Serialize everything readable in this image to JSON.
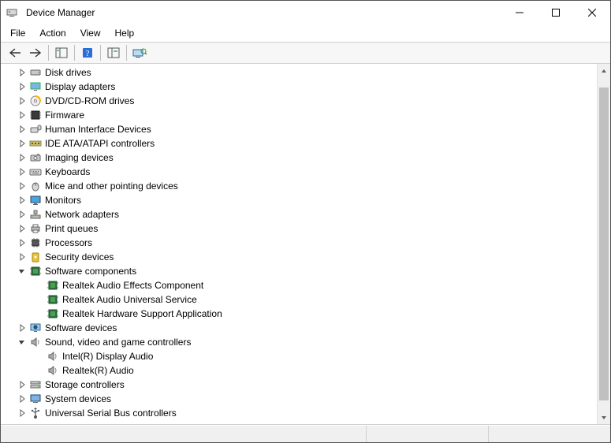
{
  "title": "Device Manager",
  "menu": {
    "items": [
      "File",
      "Action",
      "View",
      "Help"
    ]
  },
  "toolbar": {
    "back": "Back",
    "forward": "Forward",
    "show_hide": "Show/Hide Console Tree",
    "help": "Help",
    "properties": "Properties",
    "scan": "Scan for hardware changes"
  },
  "tree": [
    {
      "label": "Disk drives",
      "icon": "disk",
      "expandable": true,
      "expanded": false,
      "depth": 1
    },
    {
      "label": "Display adapters",
      "icon": "display",
      "expandable": true,
      "expanded": false,
      "depth": 1
    },
    {
      "label": "DVD/CD-ROM drives",
      "icon": "dvd",
      "expandable": true,
      "expanded": false,
      "depth": 1
    },
    {
      "label": "Firmware",
      "icon": "firmware",
      "expandable": true,
      "expanded": false,
      "depth": 1
    },
    {
      "label": "Human Interface Devices",
      "icon": "hid",
      "expandable": true,
      "expanded": false,
      "depth": 1
    },
    {
      "label": "IDE ATA/ATAPI controllers",
      "icon": "ide",
      "expandable": true,
      "expanded": false,
      "depth": 1
    },
    {
      "label": "Imaging devices",
      "icon": "imaging",
      "expandable": true,
      "expanded": false,
      "depth": 1
    },
    {
      "label": "Keyboards",
      "icon": "keyboard",
      "expandable": true,
      "expanded": false,
      "depth": 1
    },
    {
      "label": "Mice and other pointing devices",
      "icon": "mouse",
      "expandable": true,
      "expanded": false,
      "depth": 1
    },
    {
      "label": "Monitors",
      "icon": "monitor",
      "expandable": true,
      "expanded": false,
      "depth": 1
    },
    {
      "label": "Network adapters",
      "icon": "network",
      "expandable": true,
      "expanded": false,
      "depth": 1
    },
    {
      "label": "Print queues",
      "icon": "printer",
      "expandable": true,
      "expanded": false,
      "depth": 1
    },
    {
      "label": "Processors",
      "icon": "cpu",
      "expandable": true,
      "expanded": false,
      "depth": 1
    },
    {
      "label": "Security devices",
      "icon": "security",
      "expandable": true,
      "expanded": false,
      "depth": 1
    },
    {
      "label": "Software components",
      "icon": "swcomp",
      "expandable": true,
      "expanded": true,
      "depth": 1
    },
    {
      "label": "Realtek Audio Effects Component",
      "icon": "swcomp",
      "expandable": false,
      "expanded": false,
      "depth": 2
    },
    {
      "label": "Realtek Audio Universal Service",
      "icon": "swcomp",
      "expandable": false,
      "expanded": false,
      "depth": 2
    },
    {
      "label": "Realtek Hardware Support Application",
      "icon": "swcomp",
      "expandable": false,
      "expanded": false,
      "depth": 2
    },
    {
      "label": "Software devices",
      "icon": "swdev",
      "expandable": true,
      "expanded": false,
      "depth": 1
    },
    {
      "label": "Sound, video and game controllers",
      "icon": "sound",
      "expandable": true,
      "expanded": true,
      "depth": 1
    },
    {
      "label": "Intel(R) Display Audio",
      "icon": "sound",
      "expandable": false,
      "expanded": false,
      "depth": 2
    },
    {
      "label": "Realtek(R) Audio",
      "icon": "sound",
      "expandable": false,
      "expanded": false,
      "depth": 2
    },
    {
      "label": "Storage controllers",
      "icon": "storage",
      "expandable": true,
      "expanded": false,
      "depth": 1
    },
    {
      "label": "System devices",
      "icon": "system",
      "expandable": true,
      "expanded": false,
      "depth": 1
    },
    {
      "label": "Universal Serial Bus controllers",
      "icon": "usb",
      "expandable": true,
      "expanded": false,
      "depth": 1
    }
  ],
  "scrollbar": {
    "thumb_top_pct": 3,
    "thumb_height_pct": 94
  }
}
